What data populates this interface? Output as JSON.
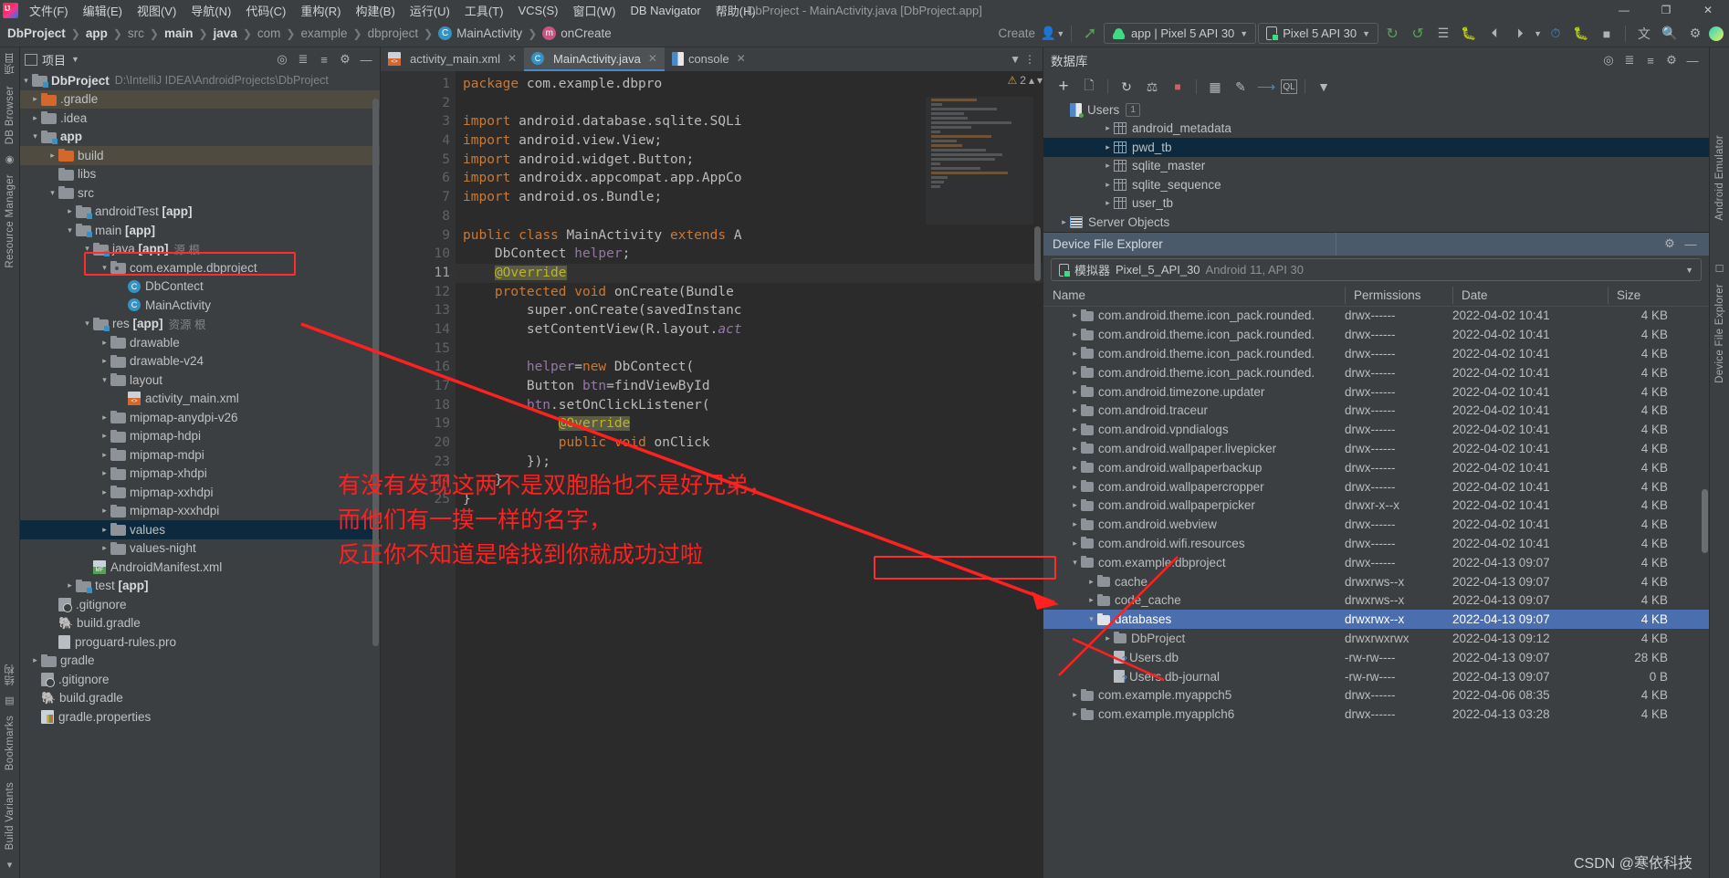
{
  "menu": {
    "items": [
      "文件(F)",
      "编辑(E)",
      "视图(V)",
      "导航(N)",
      "代码(C)",
      "重构(R)",
      "构建(B)",
      "运行(U)",
      "工具(T)",
      "VCS(S)",
      "窗口(W)",
      "DB Navigator",
      "帮助(H)"
    ],
    "window_title": "DbProject - MainActivity.java [DbProject.app]",
    "controls": {
      "minimize": "—",
      "maximize": "❐",
      "close": "✕"
    }
  },
  "navbar": {
    "crumbs": [
      "DbProject",
      "app",
      "src",
      "main",
      "java",
      "com",
      "example",
      "dbproject",
      "MainActivity",
      "onCreate"
    ],
    "class_badge": "C",
    "method_badge": "m",
    "create_label": "Create",
    "run_config": "app | Pixel 5 API 30",
    "device": "Pixel 5 API 30",
    "icons": [
      "run-icon",
      "run-with-coverage-icon",
      "apply-changes-icon",
      "debug-icon",
      "profile-icon",
      "attach-debugger-icon",
      "monitor-icon",
      "profiler-icon",
      "stop-icon",
      "translate-icon",
      "search-icon",
      "settings-icon"
    ]
  },
  "left_stripe": {
    "top": [
      "项目",
      "DB Browser",
      "Resource Manager"
    ],
    "bottom": [
      "Build Variants",
      "Bookmarks",
      "结构"
    ]
  },
  "project_panel": {
    "title": "项目",
    "header_icons": [
      "locate-icon",
      "expand-all-icon",
      "collapse-all-icon",
      "settings-icon",
      "minimize-icon"
    ],
    "root": {
      "label": "DbProject",
      "path": "D:\\IntelliJ IDEA\\AndroidProjects\\DbProject"
    },
    "tree": [
      {
        "depth": 1,
        "label": ".gradle",
        "icon": "folder-orange",
        "arrow": "closed",
        "hl": "olive"
      },
      {
        "depth": 1,
        "label": ".idea",
        "icon": "folder",
        "arrow": "closed"
      },
      {
        "depth": 1,
        "label": "app",
        "icon": "folder-module",
        "arrow": "open",
        "bold": true
      },
      {
        "depth": 2,
        "label": "build",
        "icon": "folder-orange",
        "arrow": "closed",
        "hl": "olive"
      },
      {
        "depth": 2,
        "label": "libs",
        "icon": "folder",
        "arrow": "none"
      },
      {
        "depth": 2,
        "label": "src",
        "icon": "folder",
        "arrow": "open"
      },
      {
        "depth": 3,
        "label": "androidTest",
        "suffix": "[app]",
        "icon": "folder-module",
        "arrow": "closed"
      },
      {
        "depth": 3,
        "label": "main",
        "suffix": "[app]",
        "icon": "folder-module",
        "arrow": "open"
      },
      {
        "depth": 4,
        "label": "java",
        "suffix": "[app]",
        "dim": "源 根",
        "icon": "folder-module",
        "arrow": "open"
      },
      {
        "depth": 5,
        "label": "com.example.dbproject",
        "icon": "folder-package",
        "arrow": "open",
        "boxed": true
      },
      {
        "depth": 6,
        "label": "DbContect",
        "icon": "class",
        "arrow": "none"
      },
      {
        "depth": 6,
        "label": "MainActivity",
        "icon": "class",
        "arrow": "none"
      },
      {
        "depth": 4,
        "label": "res",
        "suffix": "[app]",
        "dim": "资源 根",
        "icon": "folder-module",
        "arrow": "open"
      },
      {
        "depth": 5,
        "label": "drawable",
        "icon": "folder",
        "arrow": "closed"
      },
      {
        "depth": 5,
        "label": "drawable-v24",
        "icon": "folder",
        "arrow": "closed"
      },
      {
        "depth": 5,
        "label": "layout",
        "icon": "folder",
        "arrow": "open"
      },
      {
        "depth": 6,
        "label": "activity_main.xml",
        "icon": "xml",
        "arrow": "none"
      },
      {
        "depth": 5,
        "label": "mipmap-anydpi-v26",
        "icon": "folder",
        "arrow": "closed"
      },
      {
        "depth": 5,
        "label": "mipmap-hdpi",
        "icon": "folder",
        "arrow": "closed"
      },
      {
        "depth": 5,
        "label": "mipmap-mdpi",
        "icon": "folder",
        "arrow": "closed"
      },
      {
        "depth": 5,
        "label": "mipmap-xhdpi",
        "icon": "folder",
        "arrow": "closed"
      },
      {
        "depth": 5,
        "label": "mipmap-xxhdpi",
        "icon": "folder",
        "arrow": "closed"
      },
      {
        "depth": 5,
        "label": "mipmap-xxxhdpi",
        "icon": "folder",
        "arrow": "closed"
      },
      {
        "depth": 5,
        "label": "values",
        "icon": "folder",
        "arrow": "closed",
        "hl": "blue"
      },
      {
        "depth": 5,
        "label": "values-night",
        "icon": "folder",
        "arrow": "closed"
      },
      {
        "depth": 4,
        "label": "AndroidManifest.xml",
        "icon": "manifest",
        "arrow": "none"
      },
      {
        "depth": 3,
        "label": "test",
        "suffix": "[app]",
        "icon": "folder-module",
        "arrow": "closed"
      },
      {
        "depth": 2,
        "label": ".gitignore",
        "icon": "gitignore",
        "arrow": "none"
      },
      {
        "depth": 2,
        "label": "build.gradle",
        "icon": "gradle",
        "arrow": "none"
      },
      {
        "depth": 2,
        "label": "proguard-rules.pro",
        "icon": "file",
        "arrow": "none"
      },
      {
        "depth": 1,
        "label": "gradle",
        "icon": "folder",
        "arrow": "closed"
      },
      {
        "depth": 1,
        "label": ".gitignore",
        "icon": "gitignore",
        "arrow": "none"
      },
      {
        "depth": 1,
        "label": "build.gradle",
        "icon": "gradle",
        "arrow": "none"
      },
      {
        "depth": 1,
        "label": "gradle.properties",
        "icon": "properties",
        "arrow": "none"
      }
    ]
  },
  "editor": {
    "tabs": [
      {
        "label": "activity_main.xml",
        "icon": "xml-icon",
        "active": false,
        "closable": true
      },
      {
        "label": "MainActivity.java",
        "icon": "class-icon",
        "active": true,
        "closable": true
      },
      {
        "label": "console",
        "icon": "console-icon",
        "active": false,
        "closable": true
      }
    ],
    "warning_count": "2",
    "warning_icon": "warning-triangle-icon",
    "lines": [
      {
        "n": "1",
        "t": "package com.example.dbpro"
      },
      {
        "n": "2",
        "t": ""
      },
      {
        "n": "3",
        "t": "import android.database.sqlite.SQLi"
      },
      {
        "n": "4",
        "t": "import android.view.View;"
      },
      {
        "n": "5",
        "t": "import android.widget.Button;"
      },
      {
        "n": "6",
        "t": "import androidx.appcompat.app.AppCo"
      },
      {
        "n": "7",
        "t": "import android.os.Bundle;"
      },
      {
        "n": "8",
        "t": ""
      },
      {
        "n": "9",
        "t": "public class MainActivity extends A"
      },
      {
        "n": "10",
        "t": "    DbContect helper;"
      },
      {
        "n": "11",
        "t": "    @Override"
      },
      {
        "n": "12",
        "t": "    protected void onCreate(Bundle"
      },
      {
        "n": "13",
        "t": "        super.onCreate(savedInstanc"
      },
      {
        "n": "14",
        "t": "        setContentView(R.layout.act"
      },
      {
        "n": "15",
        "t": ""
      },
      {
        "n": "16",
        "t": "        helper=new DbContect("
      },
      {
        "n": "17",
        "t": "        Button btn=findViewById"
      },
      {
        "n": "18",
        "t": "        btn.setOnClickListener("
      },
      {
        "n": "19",
        "t": "            @Override"
      },
      {
        "n": "20",
        "t": "            public void onClick"
      },
      {
        "n": "23",
        "t": "        });"
      },
      {
        "n": "24",
        "t": "    }"
      },
      {
        "n": "25",
        "t": "}"
      }
    ]
  },
  "database": {
    "title": "数据库",
    "header_icons": [
      "add-datasource-icon",
      "settings-icon",
      "minimize-icon"
    ],
    "toolbar_icons": [
      "add-icon",
      "copy-icon",
      "refresh-icon",
      "sync-icon",
      "stop-icon",
      "table-icon",
      "edit-icon",
      "jump-icon",
      "console-ql-icon",
      "filter-icon"
    ],
    "tree": [
      {
        "depth": 0,
        "label": "Users",
        "icon": "sqlite-db",
        "badge": "1",
        "arrow": "none"
      },
      {
        "depth": 1,
        "label": "android_metadata",
        "icon": "table",
        "arrow": "closed"
      },
      {
        "depth": 1,
        "label": "pwd_tb",
        "icon": "table",
        "arrow": "closed",
        "selected": true
      },
      {
        "depth": 1,
        "label": "sqlite_master",
        "icon": "table",
        "arrow": "closed"
      },
      {
        "depth": 1,
        "label": "sqlite_sequence",
        "icon": "table",
        "arrow": "closed"
      },
      {
        "depth": 1,
        "label": "user_tb",
        "icon": "table",
        "arrow": "closed"
      },
      {
        "depth": 0,
        "label": "Server Objects",
        "icon": "server-objects",
        "arrow": "closed"
      }
    ]
  },
  "device_explorer": {
    "title": "Device File Explorer",
    "header_icons": [
      "settings-icon",
      "minimize-icon"
    ],
    "device": {
      "prefix": "模拟器",
      "name": "Pixel_5_API_30",
      "suffix": "Android 11, API 30"
    },
    "columns": [
      "Name",
      "Permissions",
      "Date",
      "Size"
    ],
    "rows": [
      {
        "indent": 1,
        "name": "com.android.theme.icon_pack.rounded.",
        "perm": "drwx------",
        "date": "2022-04-02 10:41",
        "size": "4 KB",
        "arrow": "closed",
        "type": "folder"
      },
      {
        "indent": 1,
        "name": "com.android.theme.icon_pack.rounded.",
        "perm": "drwx------",
        "date": "2022-04-02 10:41",
        "size": "4 KB",
        "arrow": "closed",
        "type": "folder"
      },
      {
        "indent": 1,
        "name": "com.android.theme.icon_pack.rounded.",
        "perm": "drwx------",
        "date": "2022-04-02 10:41",
        "size": "4 KB",
        "arrow": "closed",
        "type": "folder"
      },
      {
        "indent": 1,
        "name": "com.android.theme.icon_pack.rounded.",
        "perm": "drwx------",
        "date": "2022-04-02 10:41",
        "size": "4 KB",
        "arrow": "closed",
        "type": "folder"
      },
      {
        "indent": 1,
        "name": "com.android.timezone.updater",
        "perm": "drwx------",
        "date": "2022-04-02 10:41",
        "size": "4 KB",
        "arrow": "closed",
        "type": "folder"
      },
      {
        "indent": 1,
        "name": "com.android.traceur",
        "perm": "drwx------",
        "date": "2022-04-02 10:41",
        "size": "4 KB",
        "arrow": "closed",
        "type": "folder"
      },
      {
        "indent": 1,
        "name": "com.android.vpndialogs",
        "perm": "drwx------",
        "date": "2022-04-02 10:41",
        "size": "4 KB",
        "arrow": "closed",
        "type": "folder"
      },
      {
        "indent": 1,
        "name": "com.android.wallpaper.livepicker",
        "perm": "drwx------",
        "date": "2022-04-02 10:41",
        "size": "4 KB",
        "arrow": "closed",
        "type": "folder"
      },
      {
        "indent": 1,
        "name": "com.android.wallpaperbackup",
        "perm": "drwx------",
        "date": "2022-04-02 10:41",
        "size": "4 KB",
        "arrow": "closed",
        "type": "folder"
      },
      {
        "indent": 1,
        "name": "com.android.wallpapercropper",
        "perm": "drwx------",
        "date": "2022-04-02 10:41",
        "size": "4 KB",
        "arrow": "closed",
        "type": "folder"
      },
      {
        "indent": 1,
        "name": "com.android.wallpaperpicker",
        "perm": "drwxr-x--x",
        "date": "2022-04-02 10:41",
        "size": "4 KB",
        "arrow": "closed",
        "type": "folder"
      },
      {
        "indent": 1,
        "name": "com.android.webview",
        "perm": "drwx------",
        "date": "2022-04-02 10:41",
        "size": "4 KB",
        "arrow": "closed",
        "type": "folder"
      },
      {
        "indent": 1,
        "name": "com.android.wifi.resources",
        "perm": "drwx------",
        "date": "2022-04-02 10:41",
        "size": "4 KB",
        "arrow": "closed",
        "type": "folder"
      },
      {
        "indent": 1,
        "name": "com.example.dbproject",
        "perm": "drwx------",
        "date": "2022-04-13 09:07",
        "size": "4 KB",
        "arrow": "open",
        "type": "folder",
        "boxed": true
      },
      {
        "indent": 2,
        "name": "cache",
        "perm": "drwxrws--x",
        "date": "2022-04-13 09:07",
        "size": "4 KB",
        "arrow": "closed",
        "type": "folder"
      },
      {
        "indent": 2,
        "name": "code_cache",
        "perm": "drwxrws--x",
        "date": "2022-04-13 09:07",
        "size": "4 KB",
        "arrow": "closed",
        "type": "folder"
      },
      {
        "indent": 2,
        "name": "databases",
        "perm": "drwxrwx--x",
        "date": "2022-04-13 09:07",
        "size": "4 KB",
        "arrow": "open",
        "type": "folder",
        "selected": true
      },
      {
        "indent": 3,
        "name": "DbProject",
        "perm": "drwxrwxrwx",
        "date": "2022-04-13 09:12",
        "size": "4 KB",
        "arrow": "closed",
        "type": "folder"
      },
      {
        "indent": 3,
        "name": "Users.db",
        "perm": "-rw-rw----",
        "date": "2022-04-13 09:07",
        "size": "28 KB",
        "arrow": "none",
        "type": "file"
      },
      {
        "indent": 3,
        "name": "Users.db-journal",
        "perm": "-rw-rw----",
        "date": "2022-04-13 09:07",
        "size": "0 B",
        "arrow": "none",
        "type": "file"
      },
      {
        "indent": 1,
        "name": "com.example.myappch5",
        "perm": "drwx------",
        "date": "2022-04-06 08:35",
        "size": "4 KB",
        "arrow": "closed",
        "type": "folder"
      },
      {
        "indent": 1,
        "name": "com.example.myapplch6",
        "perm": "drwx------",
        "date": "2022-04-13 03:28",
        "size": "4 KB",
        "arrow": "closed",
        "type": "folder"
      }
    ]
  },
  "right_stripe": {
    "labels": [
      "Android Emulator",
      "Device File Explorer"
    ]
  },
  "annotations": {
    "line1": "有没有发现这两不是双胞胎也不是好兄弟，",
    "line2": "而他们有一摸一样的名字，",
    "line3": "反正你不知道是啥找到你就成功过啦",
    "color": "#ff2020"
  },
  "watermark": "CSDN @寒依科技"
}
